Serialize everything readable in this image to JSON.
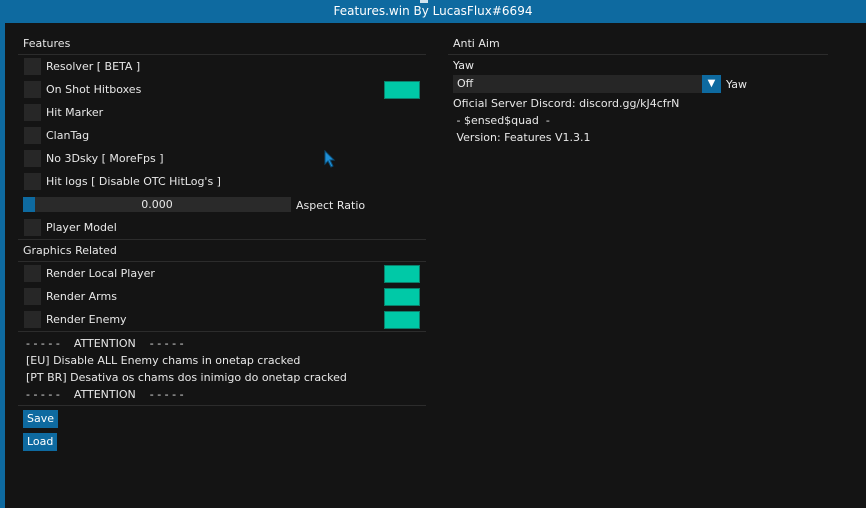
{
  "window": {
    "title": "Features.win By LucasFlux#6694"
  },
  "features": {
    "header": "Features",
    "items": [
      {
        "label": "Resolver [ BETA ]",
        "has_color": false
      },
      {
        "label": "On Shot Hitboxes",
        "has_color": true
      },
      {
        "label": "Hit Marker",
        "has_color": false
      },
      {
        "label": "ClanTag",
        "has_color": false
      },
      {
        "label": "No 3Dsky [ MoreFps ]",
        "has_color": false
      },
      {
        "label": "Hit logs [ Disable OTC HitLog's ]",
        "has_color": false
      }
    ],
    "aspect_ratio": {
      "value_text": "0.000",
      "label": "Aspect Ratio",
      "level": 0.0
    },
    "player_model": {
      "label": "Player Model"
    }
  },
  "graphics": {
    "header": "Graphics Related",
    "items": [
      {
        "label": "Render Local Player"
      },
      {
        "label": "Render Arms"
      },
      {
        "label": "Render Enemy"
      }
    ]
  },
  "attention": {
    "line1": "- - - - -    ATTENTION    - - - - -",
    "eu": "[EU] Disable ALL Enemy chams in onetap cracked",
    "ptbr": "[PT BR] Desativa os chams dos inimigo do onetap cracked",
    "line2": "- - - - -    ATTENTION    - - - - -"
  },
  "buttons": {
    "save": "Save",
    "load": "Load"
  },
  "anti_aim": {
    "header": "Anti Aim",
    "yaw_label": "Yaw",
    "yaw_value": "Off",
    "yaw_side_label": "Yaw",
    "discord": "Oficial Server Discord: discord.gg/kJ4cfrN",
    "credit": " - $ensed$quad  -",
    "version": " Version: Features V1.3.1"
  },
  "colors": {
    "accent": "#0e6aa0",
    "swatch": "#00c9a7",
    "background": "#141414"
  },
  "icons": {
    "dropdown": "triangle-down-icon",
    "cursor": "mouse-cursor-icon"
  }
}
